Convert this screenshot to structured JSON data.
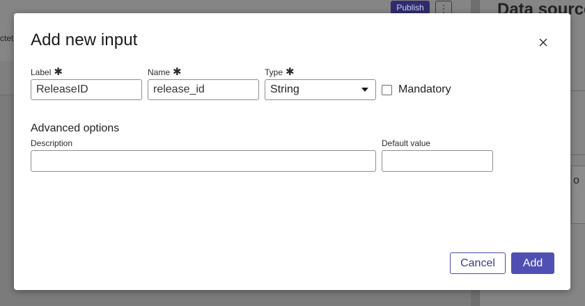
{
  "background": {
    "fragment_text": "ctetu",
    "publish_label": "Publish",
    "more_icon": "⋮",
    "panel_title": "Data sources",
    "panel_fragment": "o"
  },
  "modal": {
    "title": "Add new input",
    "close_icon": "close-icon",
    "fields": {
      "label": {
        "label": "Label",
        "value": "ReleaseID"
      },
      "name": {
        "label": "Name",
        "value": "release_id"
      },
      "type": {
        "label": "Type",
        "value": "String"
      },
      "mandatory": {
        "label": "Mandatory",
        "checked": false
      },
      "required_marker": "✱"
    },
    "advanced": {
      "title": "Advanced options",
      "description": {
        "label": "Description",
        "value": ""
      },
      "default_value": {
        "label": "Default value",
        "value": ""
      }
    },
    "buttons": {
      "cancel": "Cancel",
      "add": "Add"
    }
  },
  "colors": {
    "primary": "#4f4fb4",
    "overlay": "#7b7b7b"
  }
}
